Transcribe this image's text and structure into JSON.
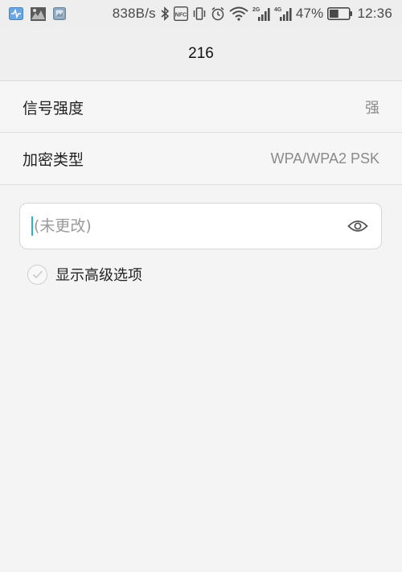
{
  "status_bar": {
    "icons_left": [
      "health-app-icon",
      "gallery-app-icon",
      "photo-app-icon"
    ],
    "net_speed": "838B/s",
    "icons_right": [
      "bluetooth-icon",
      "nfc-icon",
      "vibrate-icon",
      "alarm-icon",
      "wifi-icon",
      "signal-2g-icon",
      "signal-4g-icon",
      "battery-icon"
    ],
    "signal_2g_label": "2G",
    "signal_4g_label": "4G",
    "nfc_label": "NFC",
    "battery_percent": "47%",
    "battery_level": 0.47,
    "time": "12:36"
  },
  "header": {
    "title": "216"
  },
  "details": [
    {
      "label": "信号强度",
      "value": "强"
    },
    {
      "label": "加密类型",
      "value": "WPA/WPA2 PSK"
    }
  ],
  "password": {
    "placeholder": "(未更改)",
    "value": ""
  },
  "advanced": {
    "label": "显示高级选项",
    "checked": false
  },
  "colors": {
    "caret": "#2bb0c8",
    "background": "#f4f4f4",
    "status_bar": "#eeeeee"
  }
}
